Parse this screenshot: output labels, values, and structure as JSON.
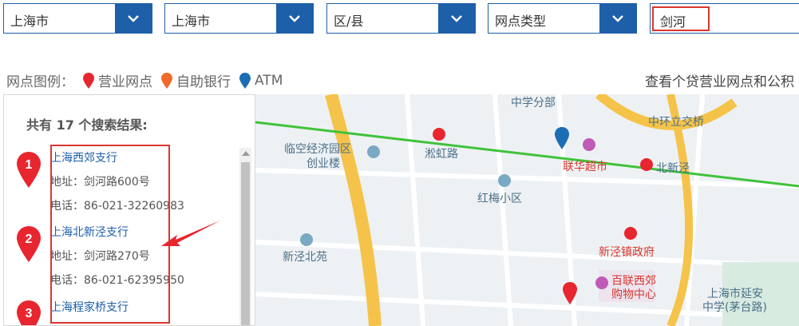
{
  "filters": {
    "province": "上海市",
    "city": "上海市",
    "district": "区/县",
    "type": "网点类型",
    "keyword": "剑河"
  },
  "legend": {
    "label": "网点图例：",
    "items": [
      {
        "label": "营业网点",
        "color": "#e8262f"
      },
      {
        "label": "自助银行",
        "color": "#f06a2a"
      },
      {
        "label": "ATM",
        "color": "#1d6db5"
      }
    ]
  },
  "link_text": "查看个贷营业网点和公积",
  "results": {
    "summary": "共有 17 个搜索结果:",
    "items": [
      {
        "num": "1",
        "name": "上海西郊支行",
        "address": "地址：剑河路600号",
        "phone": "电话：86-021-32260983"
      },
      {
        "num": "2",
        "name": "上海北新泾支行",
        "address": "地址：剑河路270号",
        "phone": "电话：86-021-62395950"
      },
      {
        "num": "3",
        "name": "上海程家桥支行",
        "address": "",
        "phone": ""
      }
    ]
  },
  "map": {
    "labels": {
      "school": "中学分部",
      "bridge": "中环立交桥",
      "lingkong": "临空经济园区",
      "chuangye": "创业楼",
      "station1": "淞虹路",
      "market": "联华超市",
      "station2": "北新泾",
      "hongmei": "红梅小区",
      "beiyuan": "新泾北苑",
      "gov": "新泾镇政府",
      "mall1": "百联西郊",
      "mall2": "购物中心",
      "yanan1": "上海市延安",
      "yanan2": "中学(茅台路)"
    }
  }
}
